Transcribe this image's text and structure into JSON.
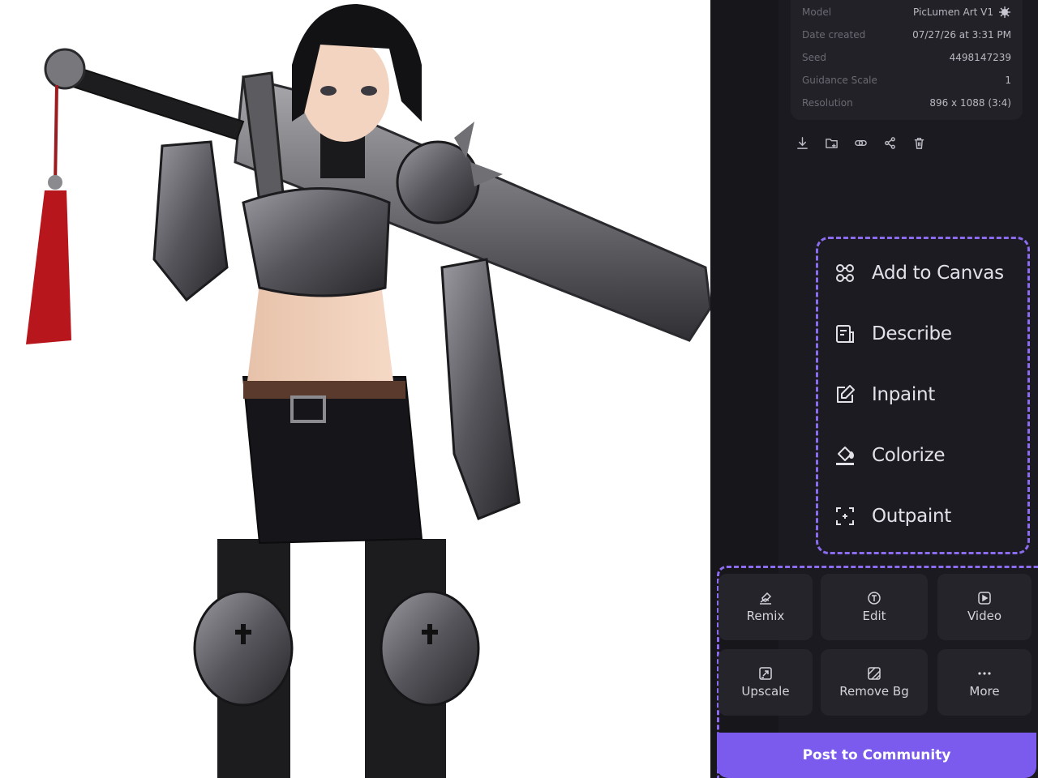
{
  "info": {
    "rows": [
      {
        "label": "Model",
        "value": "PicLumen Art V1"
      },
      {
        "label": "Date created",
        "value": "07/27/26 at 3:31 PM"
      },
      {
        "label": "Seed",
        "value": "4498147239"
      },
      {
        "label": "Guidance Scale",
        "value": "1"
      },
      {
        "label": "Resolution",
        "value": "896 x 1088 (3:4)"
      }
    ]
  },
  "toolbar": {
    "icons": [
      "download-icon",
      "folder-add-icon",
      "link-icon",
      "share-icon",
      "trash-icon"
    ]
  },
  "menu": {
    "items": [
      {
        "label": "Add to Canvas",
        "icon": "canvas-nodes-icon"
      },
      {
        "label": "Describe",
        "icon": "describe-doc-icon"
      },
      {
        "label": "Inpaint",
        "icon": "inpaint-edit-icon"
      },
      {
        "label": "Colorize",
        "icon": "paint-bucket-icon"
      },
      {
        "label": "Outpaint",
        "icon": "expand-frame-icon"
      }
    ]
  },
  "actions": {
    "remix": "Remix",
    "edit": "Edit",
    "video": "Video",
    "upscale": "Upscale",
    "remove_bg": "Remove Bg",
    "more": "More"
  },
  "post_label": "Post to Community",
  "colors": {
    "accent": "#7a5bee",
    "panel_bg": "#17161b",
    "card_bg": "#25242b"
  }
}
